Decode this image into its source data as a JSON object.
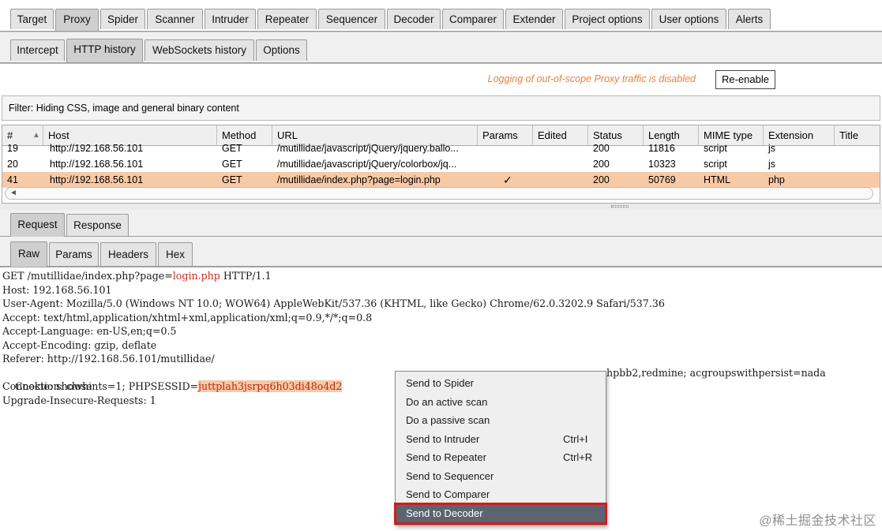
{
  "main_tabs": [
    "Target",
    "Proxy",
    "Spider",
    "Scanner",
    "Intruder",
    "Repeater",
    "Sequencer",
    "Decoder",
    "Comparer",
    "Extender",
    "Project options",
    "User options",
    "Alerts"
  ],
  "main_active": "Proxy",
  "proxy_tabs": [
    "Intercept",
    "HTTP history",
    "WebSockets history",
    "Options"
  ],
  "proxy_active": "HTTP history",
  "logging": {
    "message": "Logging of out-of-scope Proxy traffic is disabled",
    "button": "Re-enable"
  },
  "filter": "Filter: Hiding CSS, image and general binary content",
  "table": {
    "columns": [
      "#",
      "Host",
      "Method",
      "URL",
      "Params",
      "Edited",
      "Status",
      "Length",
      "MIME type",
      "Extension",
      "Title"
    ],
    "sort_icon": "sort-up-icon",
    "rows": [
      {
        "num": "19",
        "host": "http://192.168.56.101",
        "method": "GET",
        "url": "/mutillidae/javascript/jQuery/jquery.ballo...",
        "params": "",
        "edited": "",
        "status": "200",
        "length": "11816",
        "mime": "script",
        "ext": "js",
        "title": ""
      },
      {
        "num": "20",
        "host": "http://192.168.56.101",
        "method": "GET",
        "url": "/mutillidae/javascript/jQuery/colorbox/jq...",
        "params": "",
        "edited": "",
        "status": "200",
        "length": "10323",
        "mime": "script",
        "ext": "js",
        "title": ""
      },
      {
        "num": "41",
        "host": "http://192.168.56.101",
        "method": "GET",
        "url": "/mutillidae/index.php?page=login.php",
        "params": "✓",
        "edited": "",
        "status": "200",
        "length": "50769",
        "mime": "HTML",
        "ext": "php",
        "title": ""
      }
    ],
    "selected_row": "41",
    "selected_color": "#f8c9a5"
  },
  "rr_tabs": [
    "Request",
    "Response"
  ],
  "rr_active": "Request",
  "view_tabs": [
    "Raw",
    "Params",
    "Headers",
    "Hex"
  ],
  "view_active": "Raw",
  "request": {
    "line1_a": "GET /mutillidae/index.php?page=",
    "line1_b": "login.php",
    "line1_c": " HTTP/1.1",
    "lines": [
      "Host: 192.168.56.101",
      "User-Agent: Mozilla/5.0 (Windows NT 10.0; WOW64) AppleWebKit/537.36 (KHTML, like Gecko) Chrome/62.0.3202.9 Safari/537.36",
      "Accept: text/html,application/xhtml+xml,application/xml;q=0.9,*/*;q=0.8",
      "Accept-Language: en-US,en;q=0.5",
      "Accept-Encoding: gzip, deflate",
      "Referer: http://192.168.56.101/mutillidae/"
    ],
    "cookie_a": "Cookie: showhints=1; PHPSESSID=",
    "cookie_sel": "juttplah3jsrpq6h03di48o4d2",
    "cookie_b": "hpbb2,redmine; acgroupswithpersist=nada",
    "lines_after": [
      "Connection: close",
      "Upgrade-Insecure-Requests: 1"
    ]
  },
  "context_menu": {
    "items": [
      {
        "label": "Send to Spider",
        "shortcut": ""
      },
      {
        "label": "Do an active scan",
        "shortcut": ""
      },
      {
        "label": "Do a passive scan",
        "shortcut": ""
      },
      {
        "label": "Send to Intruder",
        "shortcut": "Ctrl+I"
      },
      {
        "label": "Send to Repeater",
        "shortcut": "Ctrl+R"
      },
      {
        "label": "Send to Sequencer",
        "shortcut": ""
      },
      {
        "label": "Send to Comparer",
        "shortcut": ""
      },
      {
        "label": "Send to Decoder",
        "shortcut": ""
      }
    ],
    "focused": "Send to Decoder",
    "highlight_color": "#d41c1c"
  },
  "watermark": "@稀土掘金技术社区"
}
